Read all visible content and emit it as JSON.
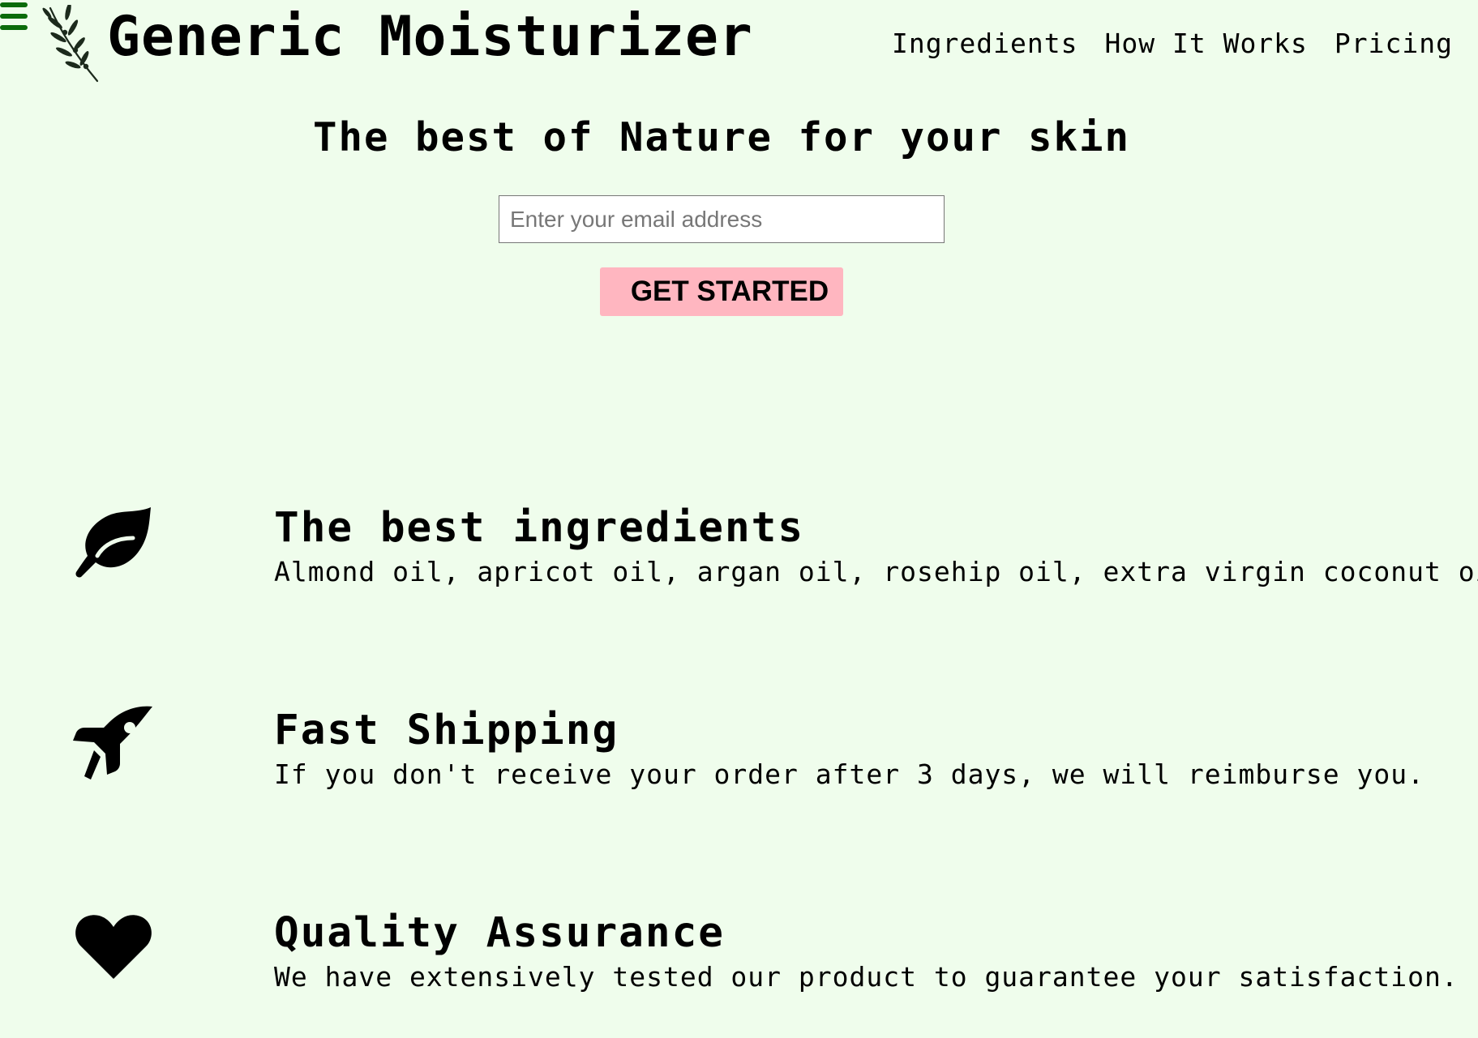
{
  "header": {
    "brand": "Generic Moisturizer",
    "nav": [
      {
        "label": "Ingredients"
      },
      {
        "label": "How It Works"
      },
      {
        "label": "Pricing"
      }
    ]
  },
  "hero": {
    "title": "The best of Nature for your skin",
    "email_placeholder": "Enter your email address",
    "cta_label": "GET STARTED"
  },
  "features": [
    {
      "icon": "leaf-icon",
      "title": "The best ingredients",
      "desc": "Almond oil, apricot oil, argan oil, rosehip oil, extra virgin coconut oil."
    },
    {
      "icon": "rocket-icon",
      "title": "Fast Shipping",
      "desc": "If you don't receive your order after 3 days, we will reimburse you."
    },
    {
      "icon": "heart-icon",
      "title": "Quality Assurance",
      "desc": "We have extensively tested our product to guarantee your satisfaction."
    }
  ],
  "colors": {
    "background": "#effdec",
    "menu_icon": "#0a6b0a",
    "cta_background": "#ffb6c0"
  }
}
